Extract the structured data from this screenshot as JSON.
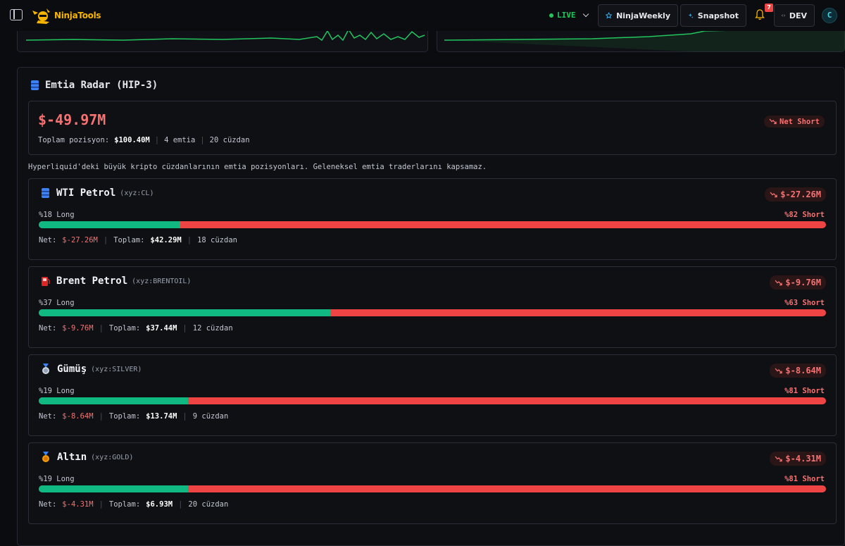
{
  "header": {
    "brand": "NinjaTools",
    "live_label": "LIVE",
    "weekly_label": "NinjaWeekly",
    "snapshot_label": "Snapshot",
    "notification_count": "7",
    "dev_label": "DEV",
    "avatar_initial": "C"
  },
  "panel": {
    "title": "Emtia Radar (HIP-3)",
    "net_value": "$-49.97M",
    "net_direction": "Net Short",
    "total_label": "Toplam pozisyon:",
    "total_value": "$100.40M",
    "commodity_count": "4 emtia",
    "wallet_count": "20 cüzdan",
    "description": "Hyperliquid'deki büyük kripto cüzdanlarının emtia pozisyonları. Geleneksel emtia traderlarını kapsamaz."
  },
  "commodities": [
    {
      "icon": "oil-barrel-icon",
      "name": "WTI Petrol",
      "symbol": "(xyz:CL)",
      "net_badge": "$-27.26M",
      "long_label": "%18 Long",
      "short_label": "%82 Short",
      "long_pct": 18,
      "net_label": "Net:",
      "net_value": "$-27.26M",
      "total_label": "Toplam:",
      "total_value": "$42.29M",
      "wallets": "18 cüzdan"
    },
    {
      "icon": "fuel-pump-icon",
      "name": "Brent Petrol",
      "symbol": "(xyz:BRENTOIL)",
      "net_badge": "$-9.76M",
      "long_label": "%37 Long",
      "short_label": "%63 Short",
      "long_pct": 37,
      "net_label": "Net:",
      "net_value": "$-9.76M",
      "total_label": "Toplam:",
      "total_value": "$37.44M",
      "wallets": "12 cüzdan"
    },
    {
      "icon": "silver-medal-icon",
      "name": "Gümüş",
      "symbol": "(xyz:SILVER)",
      "net_badge": "$-8.64M",
      "long_label": "%19 Long",
      "short_label": "%81 Short",
      "long_pct": 19,
      "net_label": "Net:",
      "net_value": "$-8.64M",
      "total_label": "Toplam:",
      "total_value": "$13.74M",
      "wallets": "9 cüzdan"
    },
    {
      "icon": "gold-medal-icon",
      "name": "Altın",
      "symbol": "(xyz:GOLD)",
      "net_badge": "$-4.31M",
      "long_label": "%19 Long",
      "short_label": "%81 Short",
      "long_pct": 19,
      "net_label": "Net:",
      "net_value": "$-4.31M",
      "total_label": "Toplam:",
      "total_value": "$6.93M",
      "wallets": "20 cüzdan"
    }
  ],
  "colors": {
    "long": "#10b981",
    "short": "#ef4444",
    "negative_text": "#f87171",
    "live": "#22c55e",
    "brand": "#f7b500"
  }
}
